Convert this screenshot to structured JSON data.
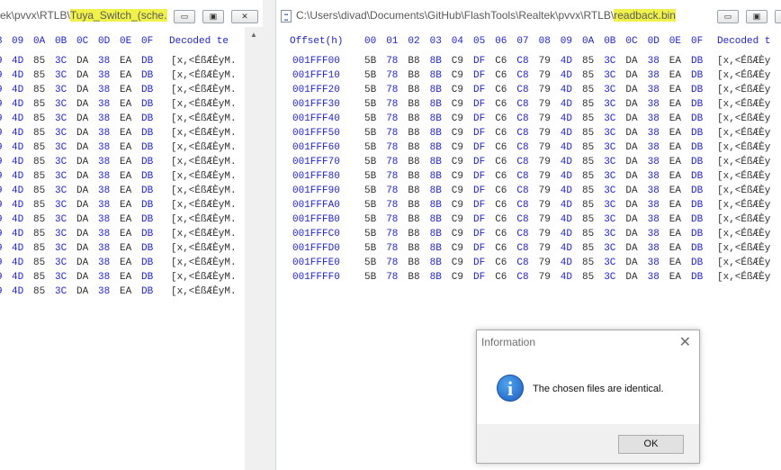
{
  "left_window": {
    "title_prefix": "ek\\pvvx\\RTLB\\",
    "title_file": "Tuya_Switch_(sche...",
    "buttons": {
      "minimize": "▭",
      "maximize": "▣",
      "close": "✕"
    },
    "header_cols": [
      "8",
      "09",
      "0A",
      "0B",
      "0C",
      "0D",
      "0E",
      "0F"
    ],
    "header_decoded": "Decoded te",
    "row_cells": [
      "9",
      "4D",
      "85",
      "3C",
      "DA",
      "38",
      "EA",
      "DB"
    ],
    "row_decoded": "[x,<ÉßÆÈyM.",
    "row_count": 17
  },
  "right_window": {
    "title_prefix": "C:\\Users\\divad\\Documents\\GitHub\\FlashTools\\Realtek\\pvvx\\RTLB\\",
    "title_file": "readback.bin",
    "buttons": {
      "minimize": "▭",
      "maximize": "▣",
      "close": "✕"
    },
    "header_offset": "Offset(h)",
    "header_cols": [
      "00",
      "01",
      "02",
      "03",
      "04",
      "05",
      "06",
      "07",
      "08",
      "09",
      "0A",
      "0B",
      "0C",
      "0D",
      "0E",
      "0F"
    ],
    "header_decoded": "Decoded t",
    "offsets": [
      "001FFF00",
      "001FFF10",
      "001FFF20",
      "001FFF30",
      "001FFF40",
      "001FFF50",
      "001FFF60",
      "001FFF70",
      "001FFF80",
      "001FFF90",
      "001FFFA0",
      "001FFFB0",
      "001FFFC0",
      "001FFFD0",
      "001FFFE0",
      "001FFFF0"
    ],
    "row_cells": [
      "5B",
      "78",
      "B8",
      "8B",
      "C9",
      "DF",
      "C6",
      "C8",
      "79",
      "4D",
      "85",
      "3C",
      "DA",
      "38",
      "EA",
      "DB"
    ],
    "row_decoded": "[x,<ÉßÆÈy"
  },
  "dialog": {
    "title": "Information",
    "close": "✕",
    "icon": "i",
    "message": "The chosen files are identical.",
    "ok_label": "OK"
  },
  "colors": {
    "highlight": "#f0f24a",
    "offset_blue": "#1e1edc",
    "hex_dark": "#303030"
  }
}
